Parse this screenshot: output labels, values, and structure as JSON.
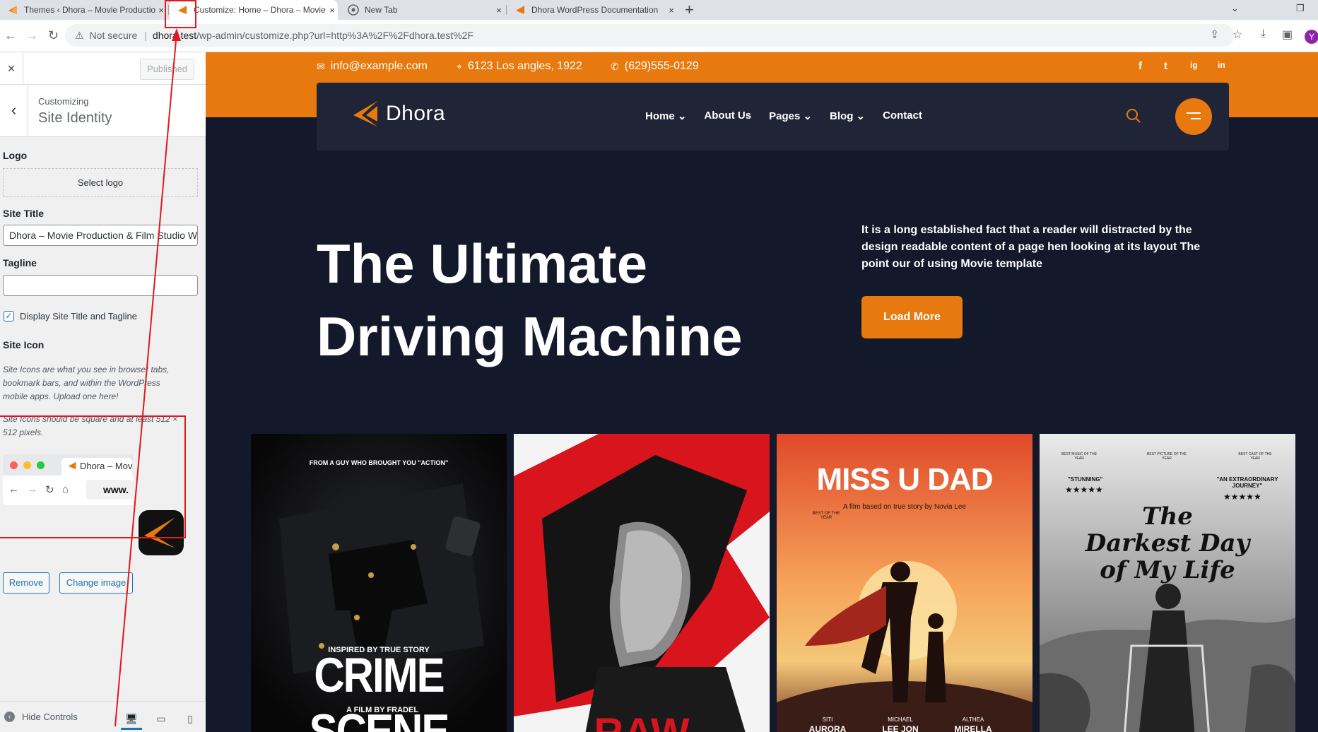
{
  "browser": {
    "tabs": [
      {
        "title": "Themes ‹ Dhora – Movie Production",
        "close": "×"
      },
      {
        "title": "Customize: Home – Dhora – Movie",
        "close": "×"
      },
      {
        "title": "New Tab",
        "close": "×"
      },
      {
        "title": "Dhora WordPress Documentation",
        "close": "×"
      }
    ],
    "new_tab": "+",
    "not_secure": "Not secure",
    "url_host": "dhora.test",
    "url_path": "/wp-admin/customize.php?url=http%3A%2F%2Fdhora.test%2F",
    "profile_initial": "Y"
  },
  "customizer": {
    "close": "×",
    "published": "Published",
    "back": "‹",
    "breadcrumb": "Customizing",
    "section_title": "Site Identity",
    "logo_label": "Logo",
    "select_logo": "Select logo",
    "site_title_label": "Site Title",
    "site_title_value": "Dhora – Movie Production & Film Studio WordPress Theme",
    "tagline_label": "Tagline",
    "tagline_value": "",
    "display_title_checked": true,
    "display_title_label": "Display Site Title and Tagline",
    "site_icon_label": "Site Icon",
    "site_icon_desc": "Site Icons are what you see in browser tabs, bookmark bars, and within the WordPress mobile apps. Upload one here!",
    "site_icon_size": "Site Icons should be square and at least 512 × 512 pixels.",
    "preview_tab_title": "Dhora – Movie",
    "preview_url": "www.",
    "remove": "Remove",
    "change_image": "Change image",
    "hide_controls": "Hide Controls"
  },
  "site": {
    "email": "info@example.com",
    "address": "6123 Los angles, 1922",
    "phone": "(629)555-0129",
    "social": [
      "f",
      "t",
      "ig",
      "in"
    ],
    "brand": "Dhora",
    "menu": [
      "Home ⌄",
      "About Us",
      "Pages ⌄",
      "Blog ⌄",
      "Contact"
    ],
    "hero_line1": "The Ultimate",
    "hero_line2": "Driving Machine",
    "hero_text": "It is a long established fact that a reader will distracted by the design readable content of a page hen looking at its layout The point our of using Movie template",
    "load_more": "Load More",
    "posters": [
      {
        "top_text": "FROM A GUY WHO BROUGHT YOU \"ACTION\"",
        "sub": "INSPIRED BY TRUE STORY",
        "title": "CRIME SCENE",
        "credit": "A FILM BY FRADEL"
      },
      {
        "title": "RAW"
      },
      {
        "title": "MISS U DAD",
        "sub": "A film based on true story by Novia Lee",
        "laurel": "BEST OF THE YEAR",
        "names": [
          "SITI",
          "MICHAEL",
          "ALTHEA"
        ],
        "surnames": [
          "AURORA",
          "LEE JON",
          "MIRELLA"
        ]
      },
      {
        "laurels": [
          "BEST MUSIC OF THE YEAR",
          "BEST PICTURE OF THE YEAR",
          "BEST CAST OF THE YEAR"
        ],
        "quote1": "\"STUNNING\"",
        "quote2": "\"AN EXTRAORDINARY JOURNEY\"",
        "stars": "★★★★★",
        "title1": "The",
        "title2": "Darkest Day",
        "title3": "of My Life"
      }
    ]
  },
  "colors": {
    "accent": "#e8790f",
    "site_bg": "#13182a",
    "nav_bg": "#1f2537",
    "wp_blue": "#2271b1",
    "annotation": "#e0191e"
  }
}
